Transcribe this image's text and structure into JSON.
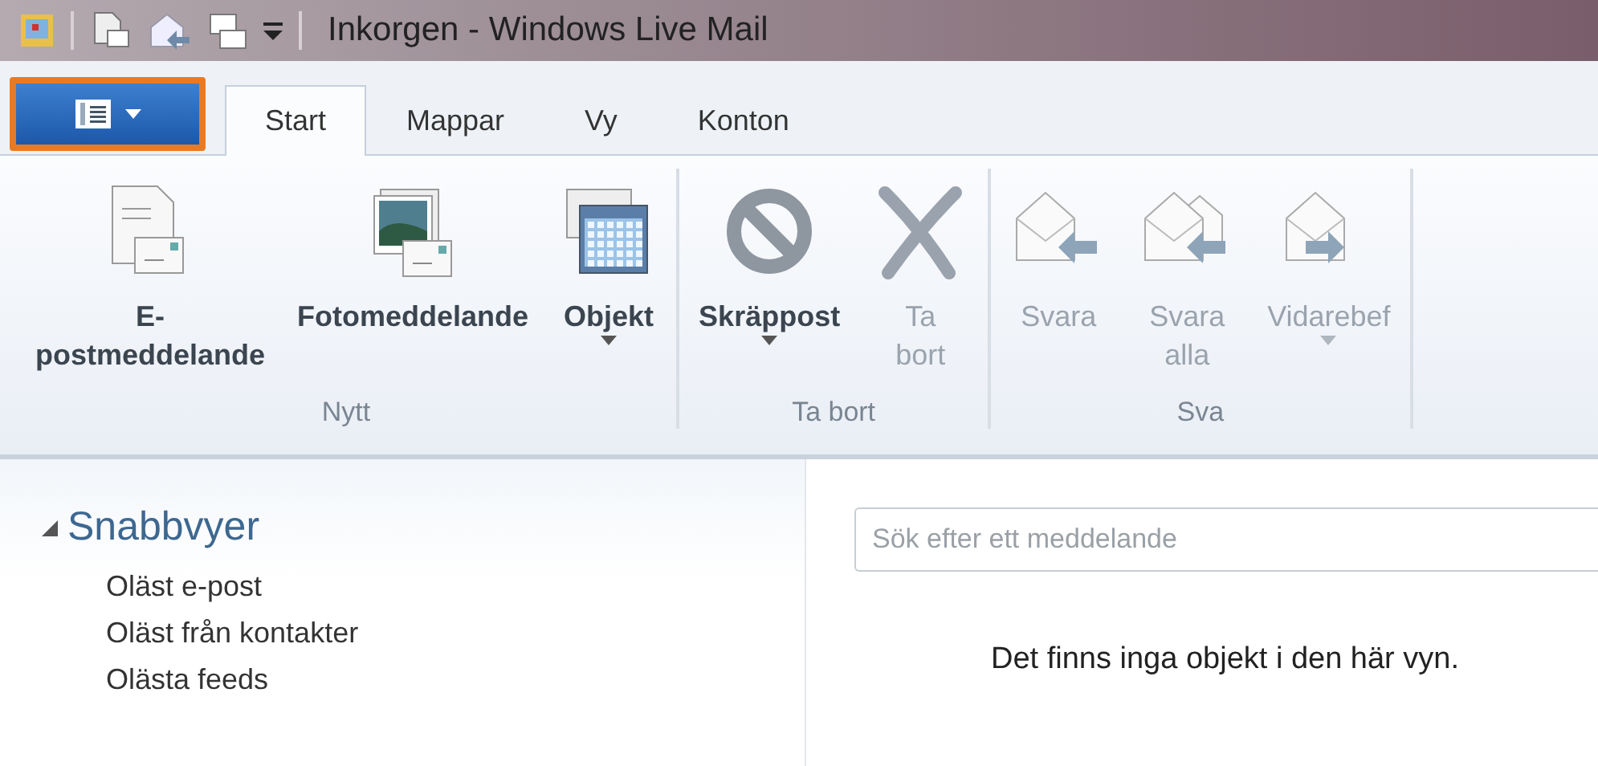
{
  "window": {
    "title": "Inkorgen - Windows Live Mail"
  },
  "app_menu": {
    "highlighted": true
  },
  "tabs": [
    {
      "label": "Start",
      "selected": true
    },
    {
      "label": "Mappar",
      "selected": false
    },
    {
      "label": "Vy",
      "selected": false
    },
    {
      "label": "Konton",
      "selected": false
    }
  ],
  "ribbon_groups": [
    {
      "label": "Nytt",
      "buttons": [
        {
          "label": "E-\npostmeddelande",
          "disabled": false,
          "dropdown": false
        },
        {
          "label": "Fotomeddelande",
          "disabled": false,
          "dropdown": false
        },
        {
          "label": "Objekt",
          "disabled": false,
          "dropdown": true
        }
      ]
    },
    {
      "label": "Ta bort",
      "buttons": [
        {
          "label": "Skräppost",
          "disabled": false,
          "dropdown": true
        },
        {
          "label": "Ta\nbort",
          "disabled": true,
          "dropdown": false
        }
      ]
    },
    {
      "label": "Sva",
      "buttons": [
        {
          "label": "Svara",
          "disabled": true,
          "dropdown": false
        },
        {
          "label": "Svara\nalla",
          "disabled": true,
          "dropdown": false
        },
        {
          "label": "Vidarebef",
          "disabled": true,
          "dropdown": true
        }
      ]
    }
  ],
  "sidebar": {
    "heading": "Snabbvyer",
    "expanded": true,
    "items": [
      "Oläst e-post",
      "Oläst från kontakter",
      "Olästa feeds"
    ]
  },
  "search": {
    "placeholder": "Sök efter ett meddelande"
  },
  "empty_message": "Det finns inga objekt i den här vyn."
}
